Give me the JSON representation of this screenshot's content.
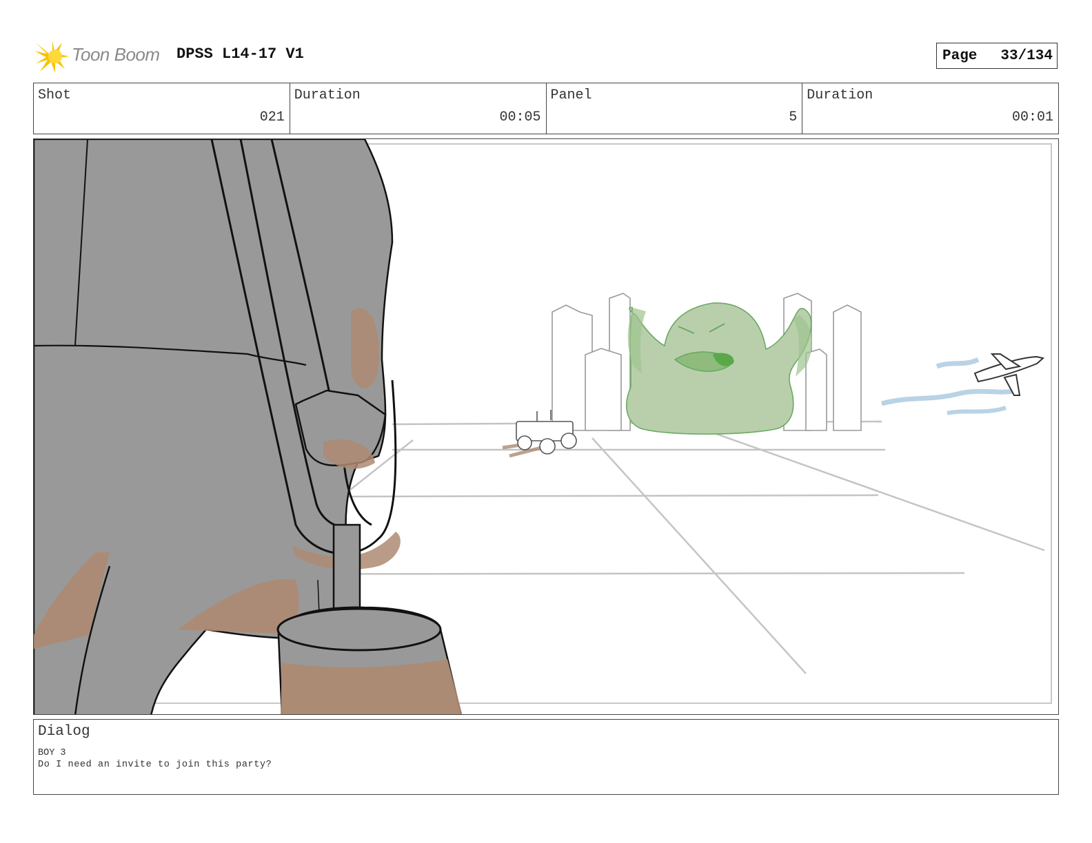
{
  "header": {
    "logo_text": "Toon Boom",
    "project_title": "DPSS L14-17 V1",
    "page_label": "Page",
    "page_value": "33/134"
  },
  "info": [
    {
      "header": "Shot",
      "value": "021"
    },
    {
      "header": "Duration",
      "value": "00:05"
    },
    {
      "header": "Panel",
      "value": "5"
    },
    {
      "header": "Duration",
      "value": "00:01"
    }
  ],
  "panel": {
    "icon": "storyboard-drawing"
  },
  "dialog": {
    "header": "Dialog",
    "speaker": "BOY 3",
    "line": "Do I need an invite to join this party?"
  },
  "colors": {
    "logo_yellow": "#f5c400",
    "body_gray": "#999999",
    "shadow_brown": "#ad8a72",
    "monster_green": "#b9cfac",
    "sky_blue": "#b9d3e6"
  }
}
